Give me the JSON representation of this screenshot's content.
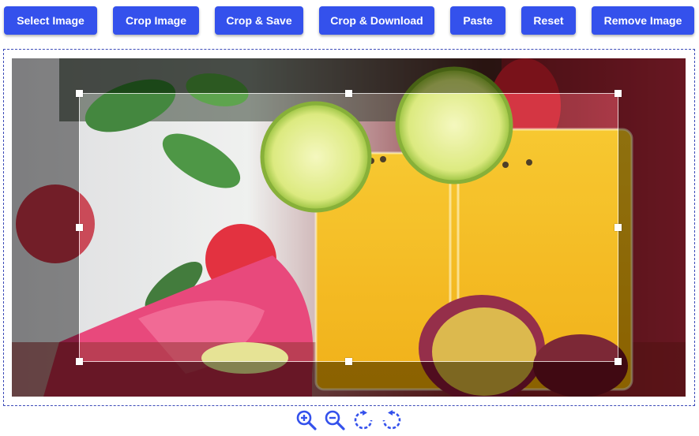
{
  "toolbar": {
    "select_image": "Select Image",
    "crop_image": "Crop Image",
    "crop_save": "Crop & Save",
    "crop_download": "Crop & Download",
    "paste": "Paste",
    "reset": "Reset",
    "remove_image": "Remove Image"
  },
  "controls": {
    "icons": [
      "zoom-in-icon",
      "zoom-out-icon",
      "rotate-right-icon",
      "rotate-left-icon"
    ]
  },
  "colors": {
    "button_bg": "#3451ec",
    "button_text": "#ffffff",
    "icon_color": "#3451ec",
    "frame_border": "#3b4ab8"
  }
}
